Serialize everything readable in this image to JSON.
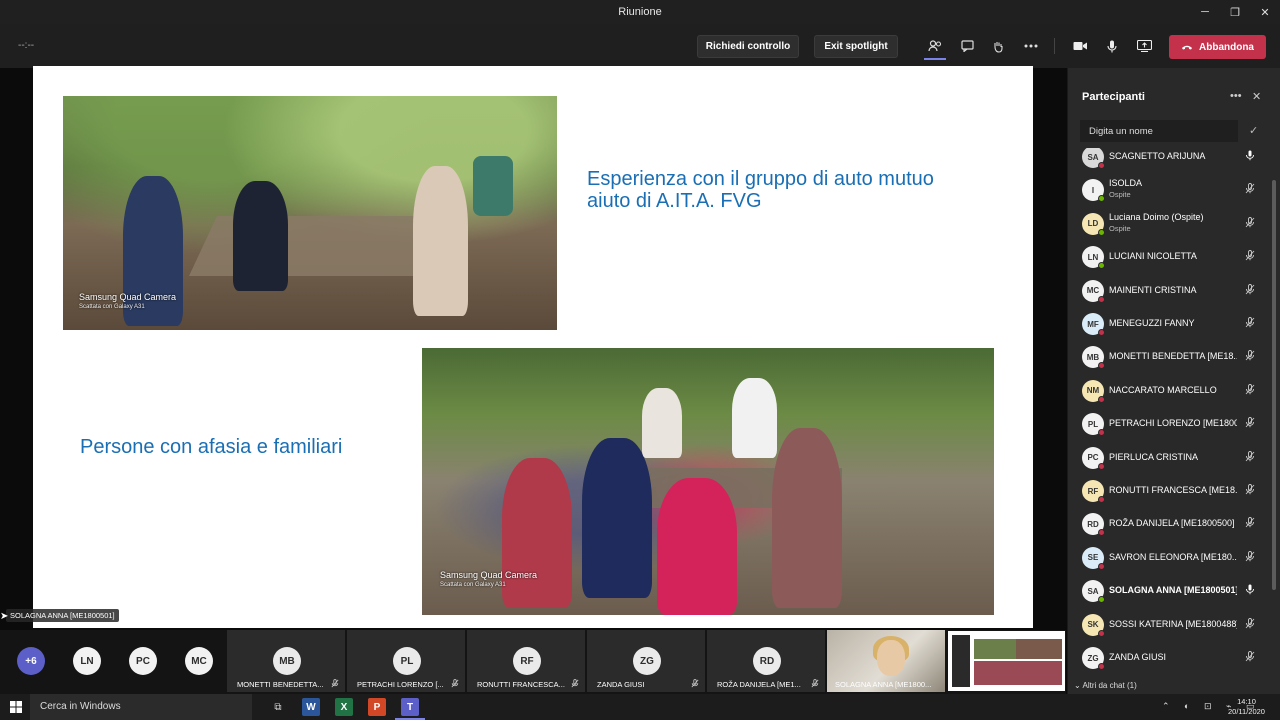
{
  "window": {
    "title": "Riunione",
    "minimize": "─",
    "maximize": "❐",
    "close": "✕"
  },
  "meeting": {
    "timer": "--:--",
    "request_control": "Richiedi controllo",
    "exit_spotlight": "Exit spotlight",
    "leave": "Abbandona",
    "icons": [
      "participants-icon",
      "chat-icon",
      "raise-hand-icon",
      "more-icon",
      "camera-icon",
      "microphone-icon",
      "share-tray-icon"
    ]
  },
  "slide": {
    "title_top": "Esperienza con il gruppo di auto mutuo aiuto di A.IT.A. FVG",
    "title_bottom": "Persone con afasia e familiari",
    "camera_label": "Samsung Quad Camera",
    "camera_sub": "Scattata con Galaxy A31"
  },
  "speaker_tag": "SOLAGNA ANNA [ME1800501]",
  "panel": {
    "title": "Partecipanti",
    "search_placeholder": "Digita un nome",
    "participants": [
      {
        "initials": "SA",
        "name": "SCAGNETTO ARIJUNA",
        "sub": "",
        "color": "#d9d9d9"
      },
      {
        "initials": "I",
        "name": "ISOLDA",
        "sub": "Ospite",
        "color": "#f2f2f2"
      },
      {
        "initials": "LD",
        "name": "Luciana Doimo (Ospite)",
        "sub": "Ospite",
        "color": "#f5e6b3"
      },
      {
        "initials": "LN",
        "name": "LUCIANI NICOLETTA",
        "sub": "",
        "color": "#f2f2f2"
      },
      {
        "initials": "MC",
        "name": "MAINENTI CRISTINA",
        "sub": "",
        "color": "#f2f2f2"
      },
      {
        "initials": "MF",
        "name": "MENEGUZZI FANNY",
        "sub": "",
        "color": "#d9ecf7"
      },
      {
        "initials": "MB",
        "name": "MONETTI BENEDETTA [ME18...",
        "sub": "",
        "color": "#f2f2f2"
      },
      {
        "initials": "NM",
        "name": "NACCARATO MARCELLO",
        "sub": "",
        "color": "#f5e6b3"
      },
      {
        "initials": "PL",
        "name": "PETRACHI LORENZO [ME1800...",
        "sub": "",
        "color": "#f2f2f2"
      },
      {
        "initials": "PC",
        "name": "PIERLUCA CRISTINA",
        "sub": "",
        "color": "#f2f2f2"
      },
      {
        "initials": "RF",
        "name": "RONUTTI FRANCESCA [ME18...",
        "sub": "",
        "color": "#f5e6b3"
      },
      {
        "initials": "RD",
        "name": "ROŽA DANIJELA [ME1800500]",
        "sub": "",
        "color": "#f2f2f2"
      },
      {
        "initials": "SE",
        "name": "SAVRON ELEONORA [ME180...",
        "sub": "",
        "color": "#d9ecf7"
      },
      {
        "initials": "SA",
        "name": "SOLAGNA ANNA [ME1800501]",
        "sub": "",
        "color": "#f2f2f2"
      },
      {
        "initials": "SK",
        "name": "SOSSI KATERINA [ME1800488]",
        "sub": "",
        "color": "#f5e6b3"
      },
      {
        "initials": "ZG",
        "name": "ZANDA GIUSI",
        "sub": "",
        "color": "#f2f2f2"
      }
    ],
    "chat_more": "Altri da chat (1)"
  },
  "strip": {
    "small": [
      {
        "initials": "+6",
        "bg": "#5b5fc7",
        "fg": "#ffffff"
      },
      {
        "initials": "LN",
        "bg": "#f2f2f2",
        "fg": "#2d2d2d"
      },
      {
        "initials": "PC",
        "bg": "#f2f2f2",
        "fg": "#2d2d2d"
      },
      {
        "initials": "MC",
        "bg": "#f2f2f2",
        "fg": "#2d2d2d"
      }
    ],
    "tiles": [
      {
        "initials": "MB",
        "label": "MONETTI BENEDETTA..."
      },
      {
        "initials": "PL",
        "label": "PETRACHI LORENZO [..."
      },
      {
        "initials": "RF",
        "label": "RONUTTI FRANCESCA..."
      },
      {
        "initials": "ZG",
        "label": "ZANDA GIUSI"
      },
      {
        "initials": "RD",
        "label": "ROŽA DANIJELA [ME1..."
      }
    ],
    "video_label": "SOLAGNA ANNA [ME1800..."
  },
  "taskbar": {
    "search": "Cerca in Windows",
    "time": "14:10",
    "date": "20/11/2020"
  }
}
